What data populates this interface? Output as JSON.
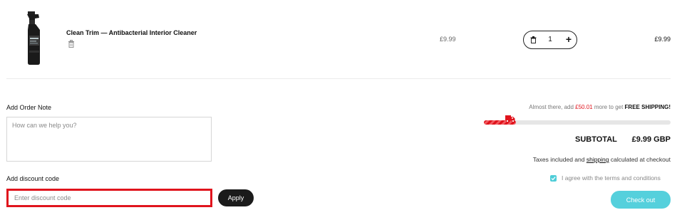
{
  "cart_item": {
    "title": "Clean Trim — Antibacterial Interior Cleaner",
    "unit_price": "£9.99",
    "quantity": "1",
    "line_total": "£9.99"
  },
  "order_note": {
    "label": "Add Order Note",
    "placeholder": "How can we help you?"
  },
  "discount": {
    "label": "Add discount code",
    "placeholder": "Enter discount code",
    "apply_label": "Apply"
  },
  "shipping": {
    "prefix": "Almost there, add ",
    "amount": "£50.01",
    "middle": " more to get ",
    "free": "FREE SHIPPING!",
    "progress": 0.17
  },
  "summary": {
    "subtotal_label": "SUBTOTAL",
    "subtotal_value": "£9.99 GBP",
    "tax_prefix": "Taxes included and ",
    "tax_link": "shipping",
    "tax_suffix": " calculated at checkout",
    "agree_text": "I agree with the terms and conditions",
    "checkout_label": "Check out"
  },
  "colors": {
    "accent_red": "#e0141d",
    "checkout_teal": "#55d0dc",
    "checkbox_teal": "#4ecdd8"
  }
}
